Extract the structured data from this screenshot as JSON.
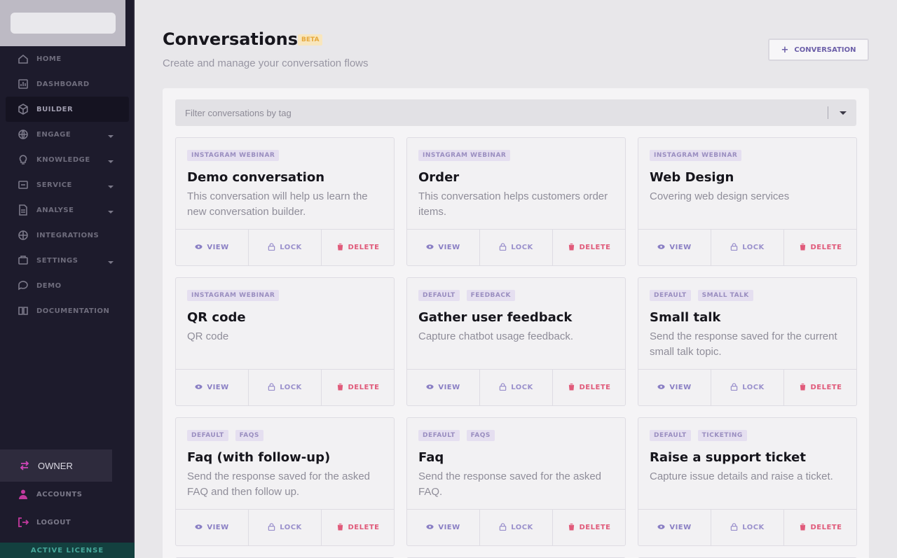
{
  "sidebar": {
    "brand": "",
    "items": [
      {
        "label": "HOME",
        "icon": "home-icon",
        "caret": false,
        "active": false
      },
      {
        "label": "DASHBOARD",
        "icon": "dashboard-icon",
        "caret": false,
        "active": false
      },
      {
        "label": "BUILDER",
        "icon": "cube-icon",
        "caret": false,
        "active": true
      },
      {
        "label": "ENGAGE",
        "icon": "globe-icon",
        "caret": true,
        "active": false
      },
      {
        "label": "KNOWLEDGE",
        "icon": "lightbulb-icon",
        "caret": true,
        "active": false
      },
      {
        "label": "SERVICE",
        "icon": "service-icon",
        "caret": true,
        "active": false
      },
      {
        "label": "ANALYSE",
        "icon": "report-icon",
        "caret": true,
        "active": false
      },
      {
        "label": "INTEGRATIONS",
        "icon": "integrations-icon",
        "caret": false,
        "active": false
      },
      {
        "label": "SETTINGS",
        "icon": "settings-icon",
        "caret": true,
        "active": false
      },
      {
        "label": "DEMO",
        "icon": "chat-icon",
        "caret": false,
        "active": false
      },
      {
        "label": "DOCUMENTATION",
        "icon": "book-icon",
        "caret": false,
        "active": false
      }
    ],
    "owner_label": "OWNER",
    "accounts_label": "ACCOUNTS",
    "logout_label": "LOGOUT",
    "license_label": "ACTIVE LICENSE"
  },
  "header": {
    "title": "Conversations",
    "badge": "BETA",
    "subtitle": "Create and manage your conversation flows",
    "new_button": "CONVERSATION"
  },
  "filter": {
    "placeholder": "Filter conversations by tag"
  },
  "actions": {
    "view": "VIEW",
    "lock": "LOCK",
    "delete": "DELETE"
  },
  "cards": [
    {
      "tags": [
        "INSTAGRAM WEBINAR"
      ],
      "title": "Demo conversation",
      "description": "This conversation will help us learn the new conversation builder."
    },
    {
      "tags": [
        "INSTAGRAM WEBINAR"
      ],
      "title": "Order",
      "description": "This conversation helps customers order items."
    },
    {
      "tags": [
        "INSTAGRAM WEBINAR"
      ],
      "title": "Web Design",
      "description": "Covering web design services"
    },
    {
      "tags": [
        "INSTAGRAM WEBINAR"
      ],
      "title": "QR code",
      "description": "QR code"
    },
    {
      "tags": [
        "DEFAULT",
        "FEEDBACK"
      ],
      "title": "Gather user feedback",
      "description": "Capture chatbot usage feedback."
    },
    {
      "tags": [
        "DEFAULT",
        "SMALL TALK"
      ],
      "title": "Small talk",
      "description": "Send the response saved for the current small talk topic."
    },
    {
      "tags": [
        "DEFAULT",
        "FAQS"
      ],
      "title": "Faq (with follow-up)",
      "description": "Send the response saved for the asked FAQ and then follow up."
    },
    {
      "tags": [
        "DEFAULT",
        "FAQS"
      ],
      "title": "Faq",
      "description": "Send the response saved for the asked FAQ."
    },
    {
      "tags": [
        "DEFAULT",
        "TICKETING"
      ],
      "title": "Raise a support ticket",
      "description": "Capture issue details and raise a ticket."
    }
  ],
  "colors": {
    "sidebar_bg": "#1d1b2c",
    "accent": "#6c5fa8",
    "delete": "#e05a7a",
    "badge": "#e6a83c",
    "license": "#46a79a"
  }
}
